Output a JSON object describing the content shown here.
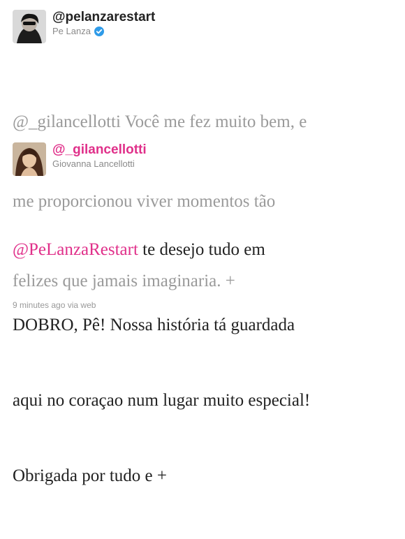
{
  "tweet1": {
    "handle": "@pelanzarestart",
    "name": "Pe Lanza",
    "verified_icon": "verified-badge-icon",
    "mention": "@_gilancellotti",
    "lines": [
      " Você me fez muito bem, e",
      "me proporcionou viver momentos tão",
      "felizes que jamais imaginaria. +"
    ]
  },
  "tweet2": {
    "handle": "@_gilancellotti",
    "name": "Giovanna Lancellotti",
    "mention": "@PeLanzaRestart",
    "lines": [
      " te desejo tudo em",
      "DOBRO, Pê! Nossa história tá guardada",
      "aqui no coraçao num lugar muito especial!",
      "Obrigada por tudo e +"
    ],
    "time": "9 minutes ago",
    "via_label": "via",
    "source": "web"
  },
  "colors": {
    "mention_pink": "#e0308a",
    "verified_blue": "#2f9be8",
    "muted_gray": "#9a9a9a"
  }
}
